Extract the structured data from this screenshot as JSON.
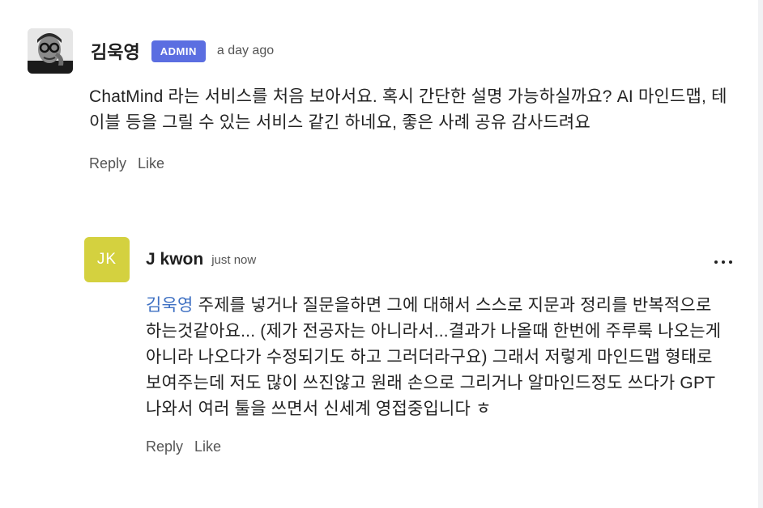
{
  "comments": [
    {
      "author": "김욱영",
      "badge": "ADMIN",
      "time": "a day ago",
      "body": "ChatMind 라는 서비스를 처음 보아서요. 혹시 간단한 설명 가능하실까요? AI 마인드맵, 테이블 등을 그릴 수 있는 서비스 같긴 하네요, 좋은 사례 공유 감사드려요",
      "reply_label": "Reply",
      "like_label": "Like"
    },
    {
      "author": "J kwon",
      "initials": "JK",
      "time": "just now",
      "mention": "김욱영",
      "body": " 주제를 넣거나 질문을하면 그에 대해서 스스로 지문과 정리를 반복적으로 하는것같아요... (제가 전공자는 아니라서...결과가 나올때 한번에 주루룩 나오는게 아니라 나오다가 수정되기도 하고 그러더라구요) 그래서 저렇게 마인드맵 형태로 보여주는데 저도 많이 쓰진않고 원래 손으로 그리거나 알마인드정도 쓰다가 GPT 나와서 여러 툴을 쓰면서 신세계 영접중입니다 ㅎ",
      "reply_label": "Reply",
      "like_label": "Like"
    }
  ],
  "colors": {
    "badge": "#5b6ee1",
    "initials_avatar": "#d4d13f",
    "mention": "#3d6fc2"
  },
  "icons": [
    "more-options-icon"
  ]
}
